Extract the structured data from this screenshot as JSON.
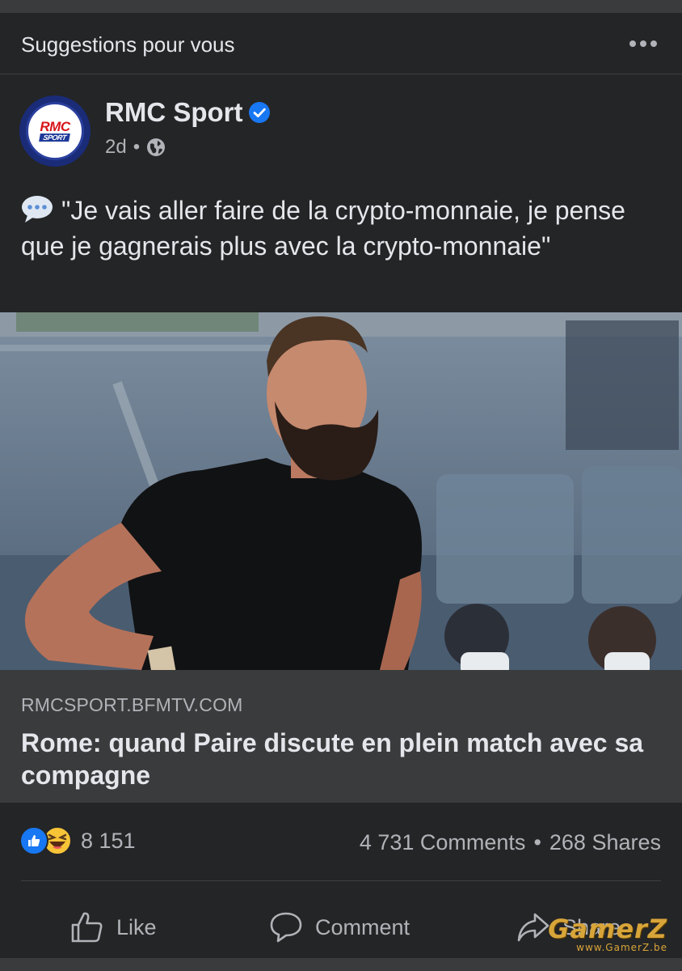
{
  "suggestions": {
    "title": "Suggestions pour vous"
  },
  "post": {
    "page_name": "RMC Sport",
    "logo_text": "RMC",
    "logo_subtext": "SPORT",
    "time": "2d",
    "dot": "•",
    "text": "\"Je vais aller faire de la crypto-monnaie, je pense que je gagnerais plus avec la crypto-monnaie\""
  },
  "link_preview": {
    "domain": "RMCSPORT.BFMTV.COM",
    "title": "Rome: quand Paire discute en plein match avec sa compagne"
  },
  "stats": {
    "reaction_count": "8 151",
    "comments": "4 731 Comments",
    "separator": "•",
    "shares": "268 Shares"
  },
  "actions": {
    "like": "Like",
    "comment": "Comment",
    "share": "Share"
  },
  "watermark": {
    "main": "GamerZ",
    "sub": "www.GamerZ.be"
  },
  "icons": {
    "more": "ellipsis-icon",
    "verified": "verified-badge-icon",
    "audience": "globe-icon",
    "speech": "speech-balloon-icon",
    "like_reaction": "like-reaction-icon",
    "haha_reaction": "haha-reaction-icon",
    "like_action": "thumbs-up-icon",
    "comment_action": "comment-bubble-icon",
    "share_action": "share-arrow-icon"
  },
  "colors": {
    "card_bg": "#242526",
    "link_bg": "#3a3b3c",
    "text_primary": "#e4e6eb",
    "text_secondary": "#b0b3b8",
    "accent_blue": "#1877f2"
  }
}
